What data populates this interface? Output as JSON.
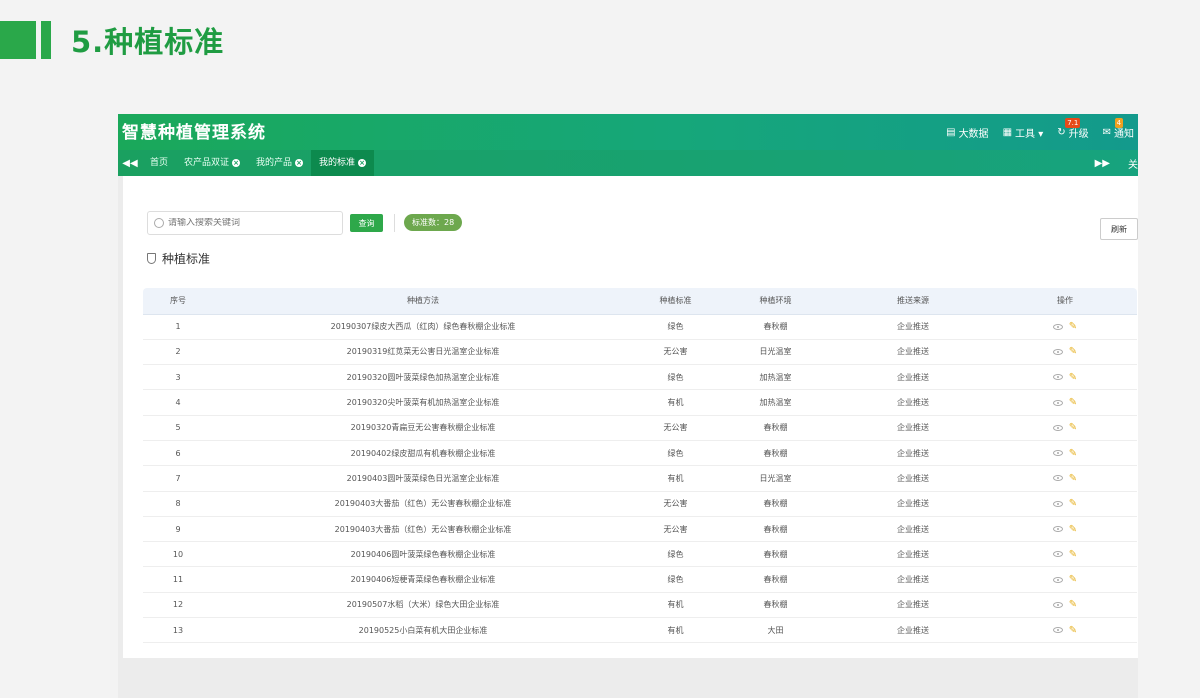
{
  "slide": {
    "title": "5.种植标准"
  },
  "app": {
    "title": "智慧种植管理系统",
    "actions": [
      {
        "label": "大数据",
        "icon": "database-icon"
      },
      {
        "label": "工具 ▾",
        "icon": "toolbox-icon"
      },
      {
        "label": "升级",
        "icon": "upgrade-icon",
        "badge": "7.1"
      },
      {
        "label": "通知",
        "icon": "envelope-icon",
        "badge": "4"
      }
    ]
  },
  "tabs": {
    "items": [
      {
        "label": "首页",
        "closable": false,
        "active": false
      },
      {
        "label": "农产品双证",
        "closable": true,
        "active": false
      },
      {
        "label": "我的产品",
        "closable": true,
        "active": false
      },
      {
        "label": "我的标准",
        "closable": true,
        "active": true
      }
    ],
    "right_label": "关"
  },
  "toolbar": {
    "search_placeholder": "请输入搜索关键词",
    "query_label": "查询",
    "count_label": "标准数：28",
    "refresh_label": "刷新"
  },
  "section": {
    "title": "种植标准"
  },
  "table": {
    "headers": [
      "序号",
      "种植方法",
      "种植标准",
      "种植环境",
      "推送来源",
      "操作"
    ],
    "rows": [
      [
        "1",
        "20190307绿皮大西瓜（红肉）绿色春秋棚企业标准",
        "绿色",
        "春秋棚",
        "企业推送"
      ],
      [
        "2",
        "20190319红苋菜无公害日光温室企业标准",
        "无公害",
        "日光温室",
        "企业推送"
      ],
      [
        "3",
        "20190320圆叶菠菜绿色加热温室企业标准",
        "绿色",
        "加热温室",
        "企业推送"
      ],
      [
        "4",
        "20190320尖叶菠菜有机加热温室企业标准",
        "有机",
        "加热温室",
        "企业推送"
      ],
      [
        "5",
        "20190320青扁豆无公害春秋棚企业标准",
        "无公害",
        "春秋棚",
        "企业推送"
      ],
      [
        "6",
        "20190402绿皮甜瓜有机春秋棚企业标准",
        "绿色",
        "春秋棚",
        "企业推送"
      ],
      [
        "7",
        "20190403圆叶菠菜绿色日光温室企业标准",
        "有机",
        "日光温室",
        "企业推送"
      ],
      [
        "8",
        "20190403大番茄（红色）无公害春秋棚企业标准",
        "无公害",
        "春秋棚",
        "企业推送"
      ],
      [
        "9",
        "20190403大番茄（红色）无公害春秋棚企业标准",
        "无公害",
        "春秋棚",
        "企业推送"
      ],
      [
        "10",
        "20190406圆叶菠菜绿色春秋棚企业标准",
        "绿色",
        "春秋棚",
        "企业推送"
      ],
      [
        "11",
        "20190406短梗青菜绿色春秋棚企业标准",
        "绿色",
        "春秋棚",
        "企业推送"
      ],
      [
        "12",
        "20190507水稻（大米）绿色大田企业标准",
        "有机",
        "春秋棚",
        "企业推送"
      ],
      [
        "13",
        "20190525小白菜有机大田企业标准",
        "有机",
        "大田",
        "企业推送"
      ]
    ]
  },
  "colors": {
    "brand_green": "#2aa84a",
    "topbar_start": "#1aa85a",
    "topbar_end": "#139a8c"
  }
}
